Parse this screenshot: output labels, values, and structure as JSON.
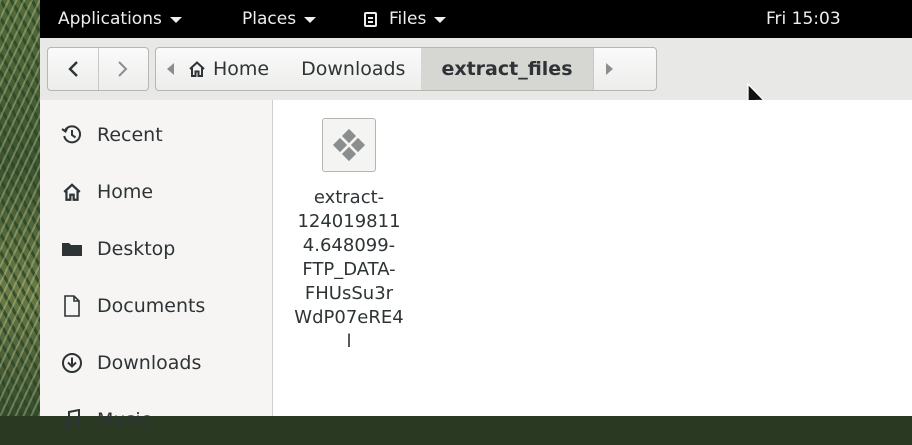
{
  "topbar": {
    "applications_label": "Applications",
    "places_label": "Places",
    "files_label": "Files",
    "clock": "Fri 15:03"
  },
  "headerbar": {
    "back_glyph": "<",
    "forward_glyph": ">",
    "path": [
      {
        "label": "Home",
        "icon": "home-icon",
        "active": false
      },
      {
        "label": "Downloads",
        "icon": null,
        "active": false
      },
      {
        "label": "extract_files",
        "icon": null,
        "active": true
      }
    ]
  },
  "sidebar": {
    "items": [
      {
        "label": "Recent",
        "icon": "recent-clock-icon"
      },
      {
        "label": "Home",
        "icon": "home-icon"
      },
      {
        "label": "Desktop",
        "icon": "folder-icon"
      },
      {
        "label": "Documents",
        "icon": "document-icon"
      },
      {
        "label": "Downloads",
        "icon": "download-icon"
      },
      {
        "label": "Music",
        "icon": "music-icon"
      }
    ]
  },
  "content": {
    "files": [
      {
        "name_lines": [
          "extract-",
          "124019811",
          "4.648099-",
          "FTP_DATA-",
          "FHUsSu3r",
          "WdP07eRE4",
          "l"
        ],
        "icon": "generic-file-icon"
      }
    ]
  },
  "colors": {
    "topbar_bg": "#000000",
    "headerbar_bg": "#e8e8e7",
    "sidebar_bg": "#f6f5f4",
    "active_crumb_bg": "#d6d6d3",
    "text": "#2e3436"
  }
}
